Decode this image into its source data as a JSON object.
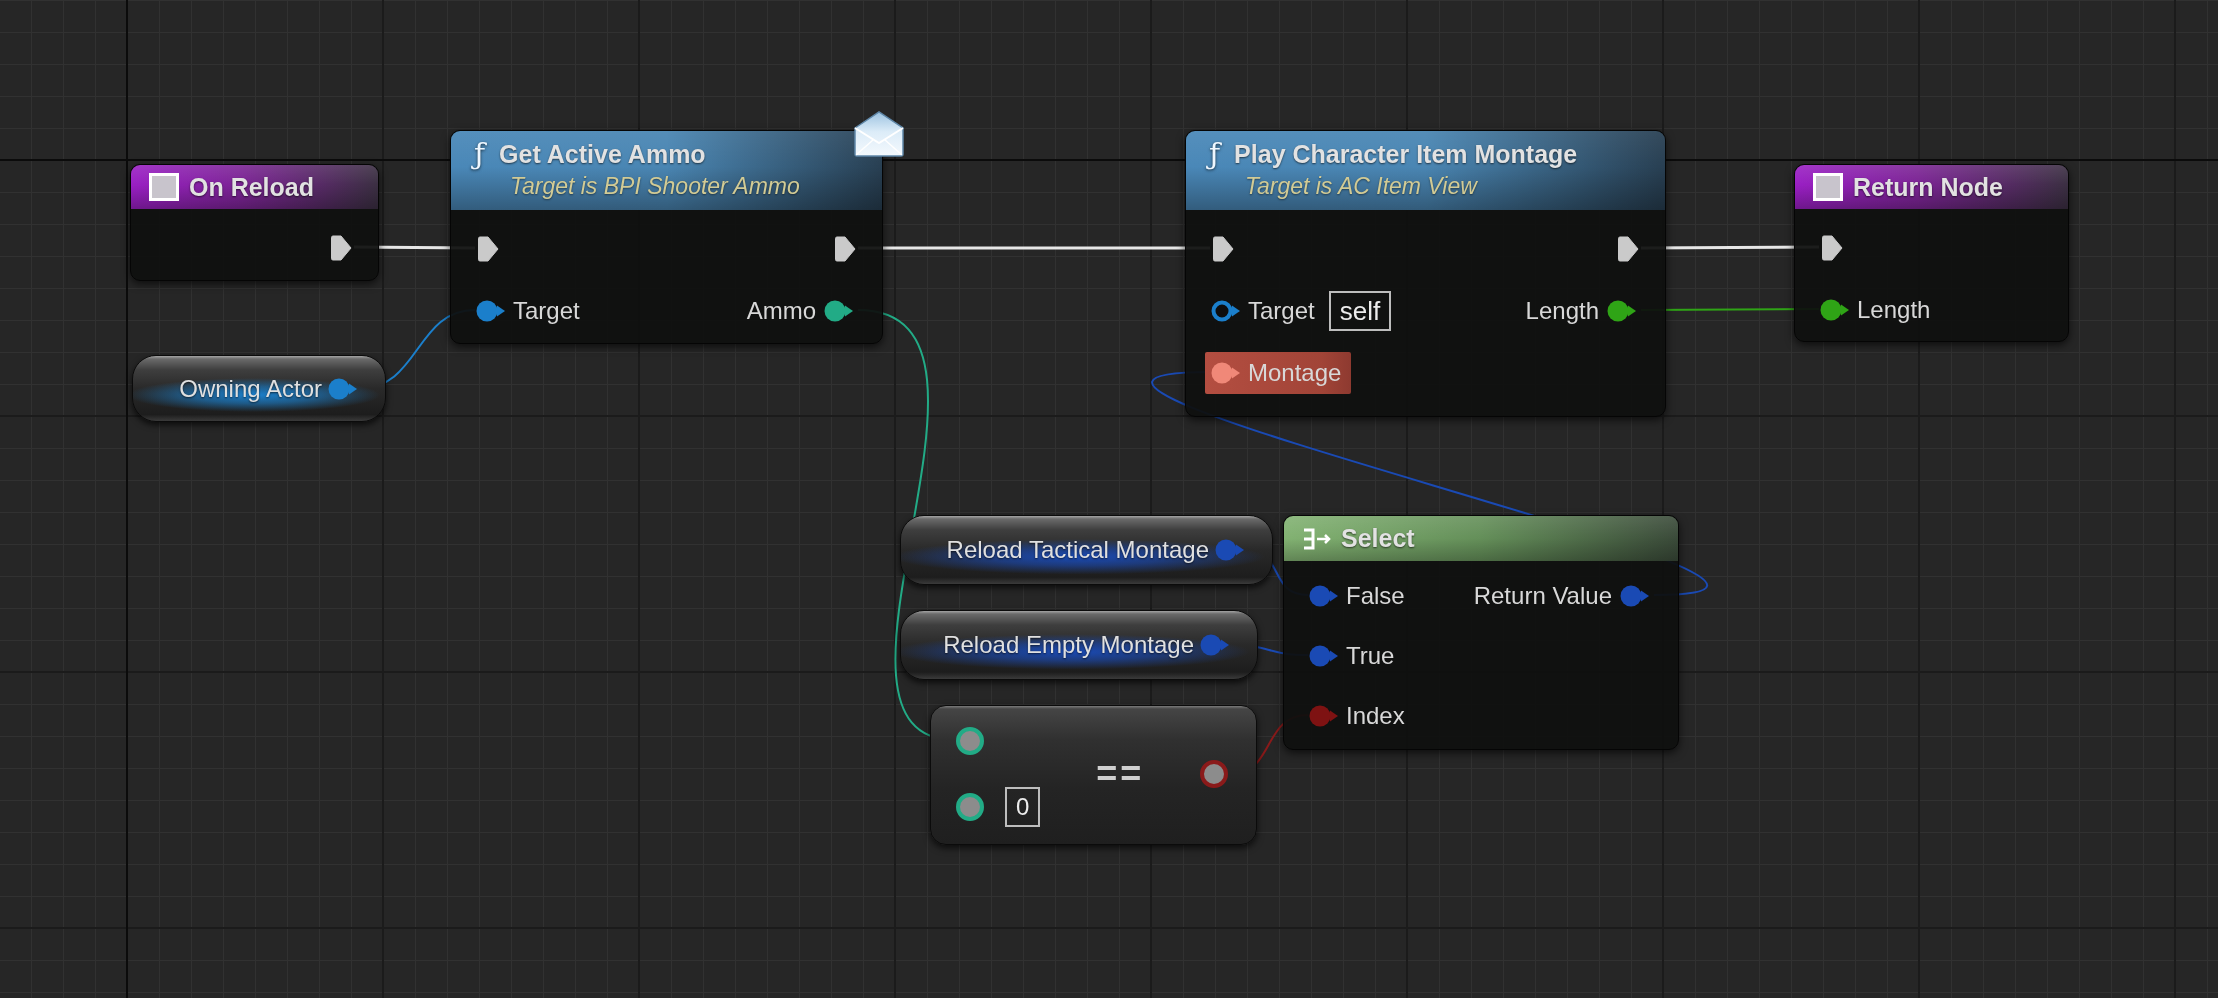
{
  "graph": {
    "nodes": [
      {
        "kind": "event",
        "title": "On Reload",
        "outputs": [
          {
            "kind": "exec",
            "connected": true
          }
        ]
      },
      {
        "kind": "function",
        "glyph": "ƒ",
        "title": "Get Active Ammo",
        "subtitle": "Target is BPI Shooter Ammo",
        "message": true,
        "inputs": [
          {
            "kind": "exec",
            "connected": true
          },
          {
            "kind": "data",
            "label": "Target",
            "color": "#1b7fcb",
            "connected": true,
            "highlighted": false
          }
        ],
        "outputs": [
          {
            "kind": "exec",
            "connected": true
          },
          {
            "kind": "data",
            "label": "Ammo",
            "color": "#22ab86",
            "connected": true,
            "highlighted": false
          }
        ]
      },
      {
        "kind": "function",
        "glyph": "ƒ",
        "title": "Play Character Item Montage",
        "subtitle": "Target is AC Item View",
        "message": false,
        "inputs": [
          {
            "kind": "exec",
            "connected": true
          },
          {
            "kind": "data",
            "label": "Target",
            "color": "#1b7fcb",
            "connected": false,
            "highlighted": false,
            "default_value": "self"
          },
          {
            "kind": "data",
            "label": "Montage",
            "color": "#f08878",
            "connected": true,
            "highlighted": true
          }
        ],
        "outputs": [
          {
            "kind": "exec",
            "connected": true
          },
          {
            "kind": "data",
            "label": "Length",
            "color": "#2fa416",
            "connected": true,
            "highlighted": false
          }
        ]
      },
      {
        "kind": "event",
        "title": "Return Node",
        "inputs": [
          {
            "kind": "exec",
            "connected": true
          },
          {
            "kind": "data",
            "label": "Length",
            "color": "#2fa416",
            "connected": true,
            "highlighted": false
          }
        ]
      },
      {
        "kind": "variable",
        "title": "Owning Actor",
        "outputs": [
          {
            "kind": "data",
            "color": "#1b7fcb",
            "connected": true
          }
        ]
      },
      {
        "kind": "variable",
        "title": "Reload Tactical Montage",
        "outputs": [
          {
            "kind": "data",
            "color": "#1a4ab4",
            "connected": true
          }
        ]
      },
      {
        "kind": "select",
        "title": "Select",
        "inputs": [
          {
            "kind": "data",
            "label": "False",
            "color": "#1a4ab4",
            "connected": true,
            "highlighted": false
          },
          {
            "kind": "data",
            "label": "True",
            "color": "#1a4ab4",
            "connected": true,
            "highlighted": false
          },
          {
            "kind": "data",
            "label": "Index",
            "color": "#7e1212",
            "connected": true,
            "highlighted": false
          }
        ],
        "outputs": [
          {
            "kind": "data",
            "label": "Return Value",
            "color": "#1a4ab4",
            "connected": true,
            "highlighted": false
          }
        ]
      },
      {
        "kind": "variable",
        "title": "Reload Empty Montage",
        "outputs": [
          {
            "kind": "data",
            "color": "#1a4ab4",
            "connected": true
          }
        ]
      },
      {
        "kind": "operator",
        "symbol": "==",
        "inputs": [
          {
            "kind": "ring",
            "color": "#22ab86"
          },
          {
            "kind": "ring",
            "color": "#22ab86",
            "default_value": "0"
          }
        ],
        "outputs": [
          {
            "kind": "ring",
            "color": "#8a1a1a"
          }
        ]
      }
    ]
  }
}
